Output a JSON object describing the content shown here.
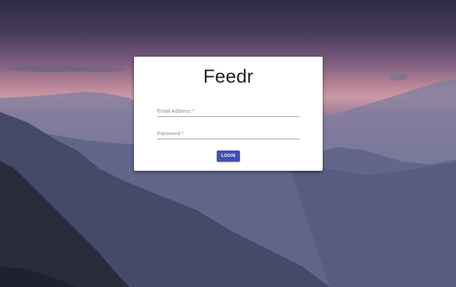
{
  "app": {
    "title": "Feedr"
  },
  "login_form": {
    "email": {
      "label": "Email Address *",
      "value": ""
    },
    "password": {
      "label": "Password *",
      "value": ""
    },
    "submit_label": "LOGIN"
  },
  "colors": {
    "accent": "#3f51b5",
    "card_background": "#ffffff",
    "sky_pink": "#c99aa7",
    "mountain_dark": "#2a2c3e"
  }
}
